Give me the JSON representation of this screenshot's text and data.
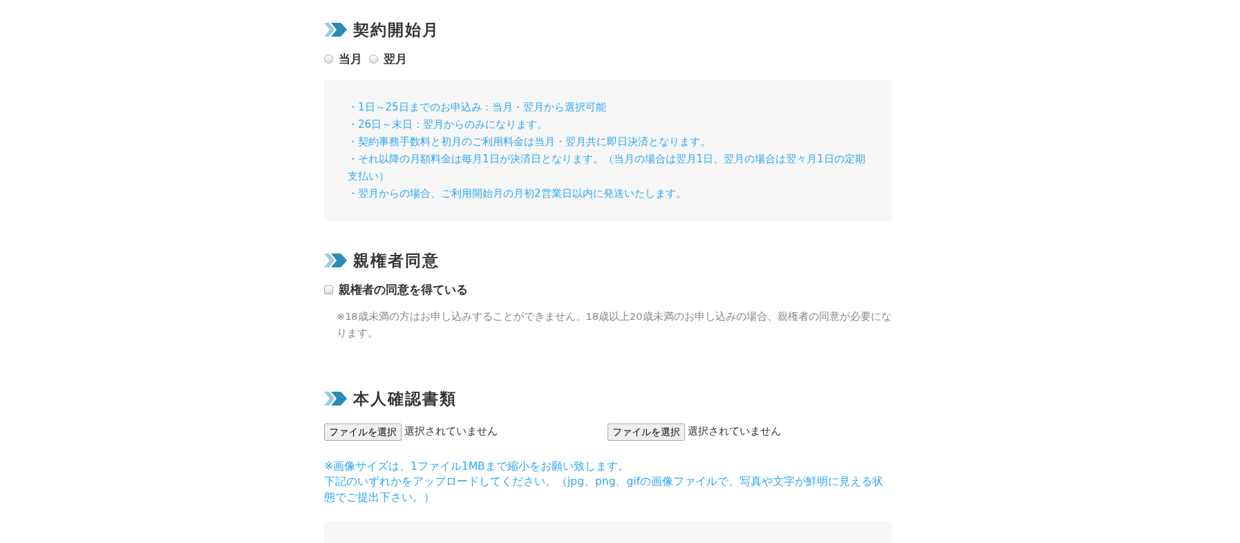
{
  "contract_start": {
    "title": "契約開始月",
    "options": [
      {
        "label": "当月",
        "selected": false
      },
      {
        "label": "翌月",
        "selected": false
      }
    ],
    "notes": [
      "・1日～25日までのお申込み：当月・翌月から選択可能",
      "・26日～末日：翌月からのみになります。",
      "・契約事務手数料と初月のご利用料金は当月・翌月共に即日決済となります。",
      "・それ以降の月額料金は毎月1日が決済日となります。（当月の場合は翌月1日、翌月の場合は翌々月1日の定期支払い）",
      "・翌月からの場合、ご利用開始月の月初2営業日以内に発送いたします。"
    ]
  },
  "parental_consent": {
    "title": "親権者同意",
    "checkbox": {
      "label": "親権者の同意を得ている",
      "checked": false
    },
    "note": "※18歳未満の方はお申し込みすることができません。18歳以上20歳未満のお申し込みの場合、親権者の同意が必要になります。"
  },
  "identity_documents": {
    "title": "本人確認書類",
    "file_inputs": [
      {
        "button": "ファイルを選択",
        "status": "選択されていません"
      },
      {
        "button": "ファイルを選択",
        "status": "選択されていません"
      }
    ],
    "notes": [
      "※画像サイズは、1ファイル1MBまで縮小をお願い致します。",
      "下記のいずれかをアップロードしてください。（jpg、png、gifの画像ファイルで、写真や文字が鮮明に見える状態でご提出下さい。）"
    ]
  }
}
